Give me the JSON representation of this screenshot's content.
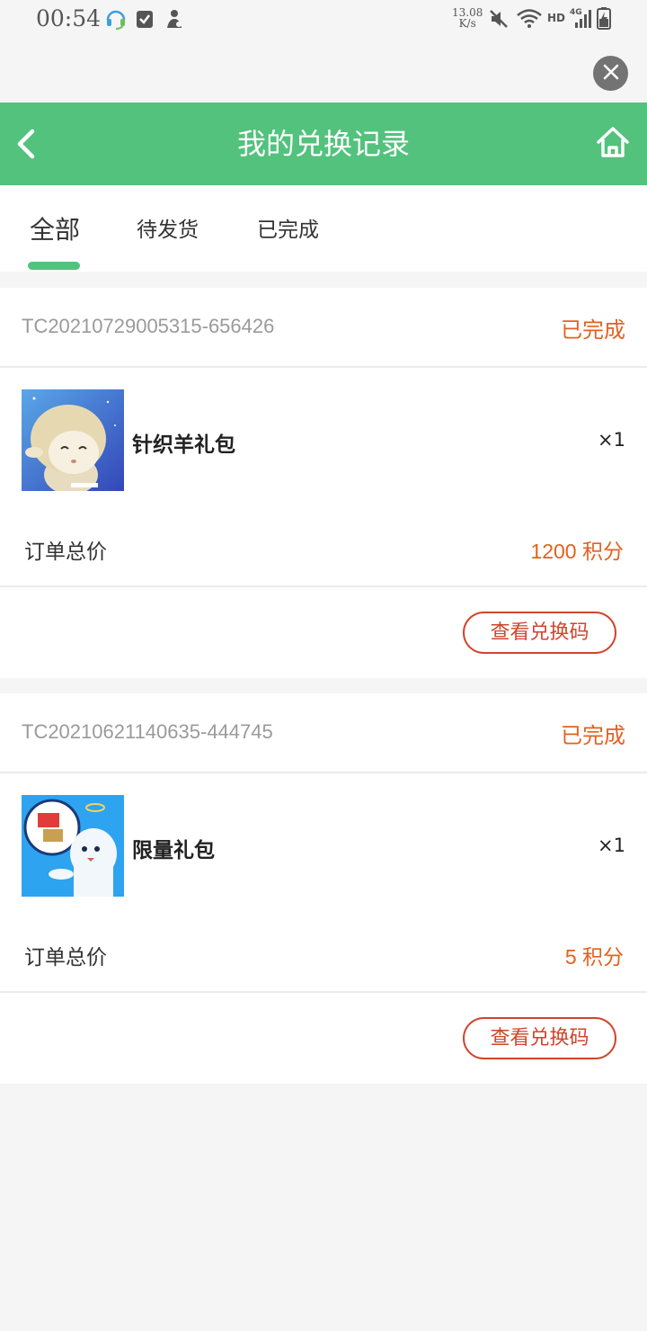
{
  "status_bar": {
    "time": "00:54",
    "speed_value": "13.08",
    "speed_unit": "K/s",
    "network": "HD",
    "signal": "4G"
  },
  "header": {
    "title": "我的兑换记录"
  },
  "tabs": [
    {
      "label": "全部",
      "active": true
    },
    {
      "label": "待发货",
      "active": false
    },
    {
      "label": "已完成",
      "active": false
    }
  ],
  "orders": [
    {
      "order_no": "TC20210729005315-656426",
      "status": "已完成",
      "item_name": "针织羊礼包",
      "quantity": "×1",
      "total_label": "订单总价",
      "total_value": "1200 积分",
      "action_label": "查看兑换码",
      "thumb_icon": "sheep-gift-icon"
    },
    {
      "order_no": "TC20210621140635-444745",
      "status": "已完成",
      "item_name": "限量礼包",
      "quantity": "×1",
      "total_label": "订单总价",
      "total_value": "5 积分",
      "action_label": "查看兑换码",
      "thumb_icon": "ghost-gift-icon"
    }
  ],
  "colors": {
    "accent": "#52c27d",
    "status": "#e4611f",
    "button": "#d0452d"
  }
}
